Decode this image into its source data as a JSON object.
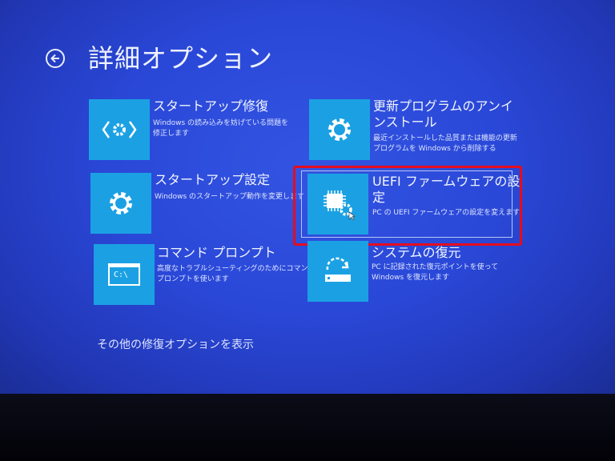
{
  "header": {
    "title": "詳細オプション",
    "back_icon": "back-arrow-icon"
  },
  "options": [
    {
      "title": "スタートアップ修復",
      "desc1": "Windows の読み込みを妨げている問題を",
      "desc2": "修正します",
      "icon": "startup-repair-icon"
    },
    {
      "title": "更新プログラムのアンイ",
      "title2": "ンストール",
      "desc1": "最近インストールした品質または機能の更新",
      "desc2": "プログラムを Windows から削除する",
      "icon": "gear-icon"
    },
    {
      "title": "スタートアップ設定",
      "desc1": "Windows のスタートアップ動作を変更します",
      "icon": "gear-icon"
    },
    {
      "title": "UEFI ファームウェアの設",
      "title2": "定",
      "desc1": "PC の UEFI ファームウェアの設定を変えます",
      "icon": "chip-gear-icon",
      "selected": true
    },
    {
      "title": "コマンド プロンプト",
      "desc1": "高度なトラブルシューティングのためにコマンド",
      "desc2": "プロンプトを使います",
      "icon": "command-prompt-icon"
    },
    {
      "title": "システムの復元",
      "desc1": "PC に記録された復元ポイントを使って",
      "desc2": "Windows を復元します",
      "icon": "system-restore-icon"
    }
  ],
  "command_prompt_glyph": "C:\\",
  "more_options": "その他の修復オプションを表示",
  "colors": {
    "background": "#2a48d8",
    "tile": "#1ba1e3",
    "highlight": "#e40d1f",
    "text": "#ffffff"
  }
}
